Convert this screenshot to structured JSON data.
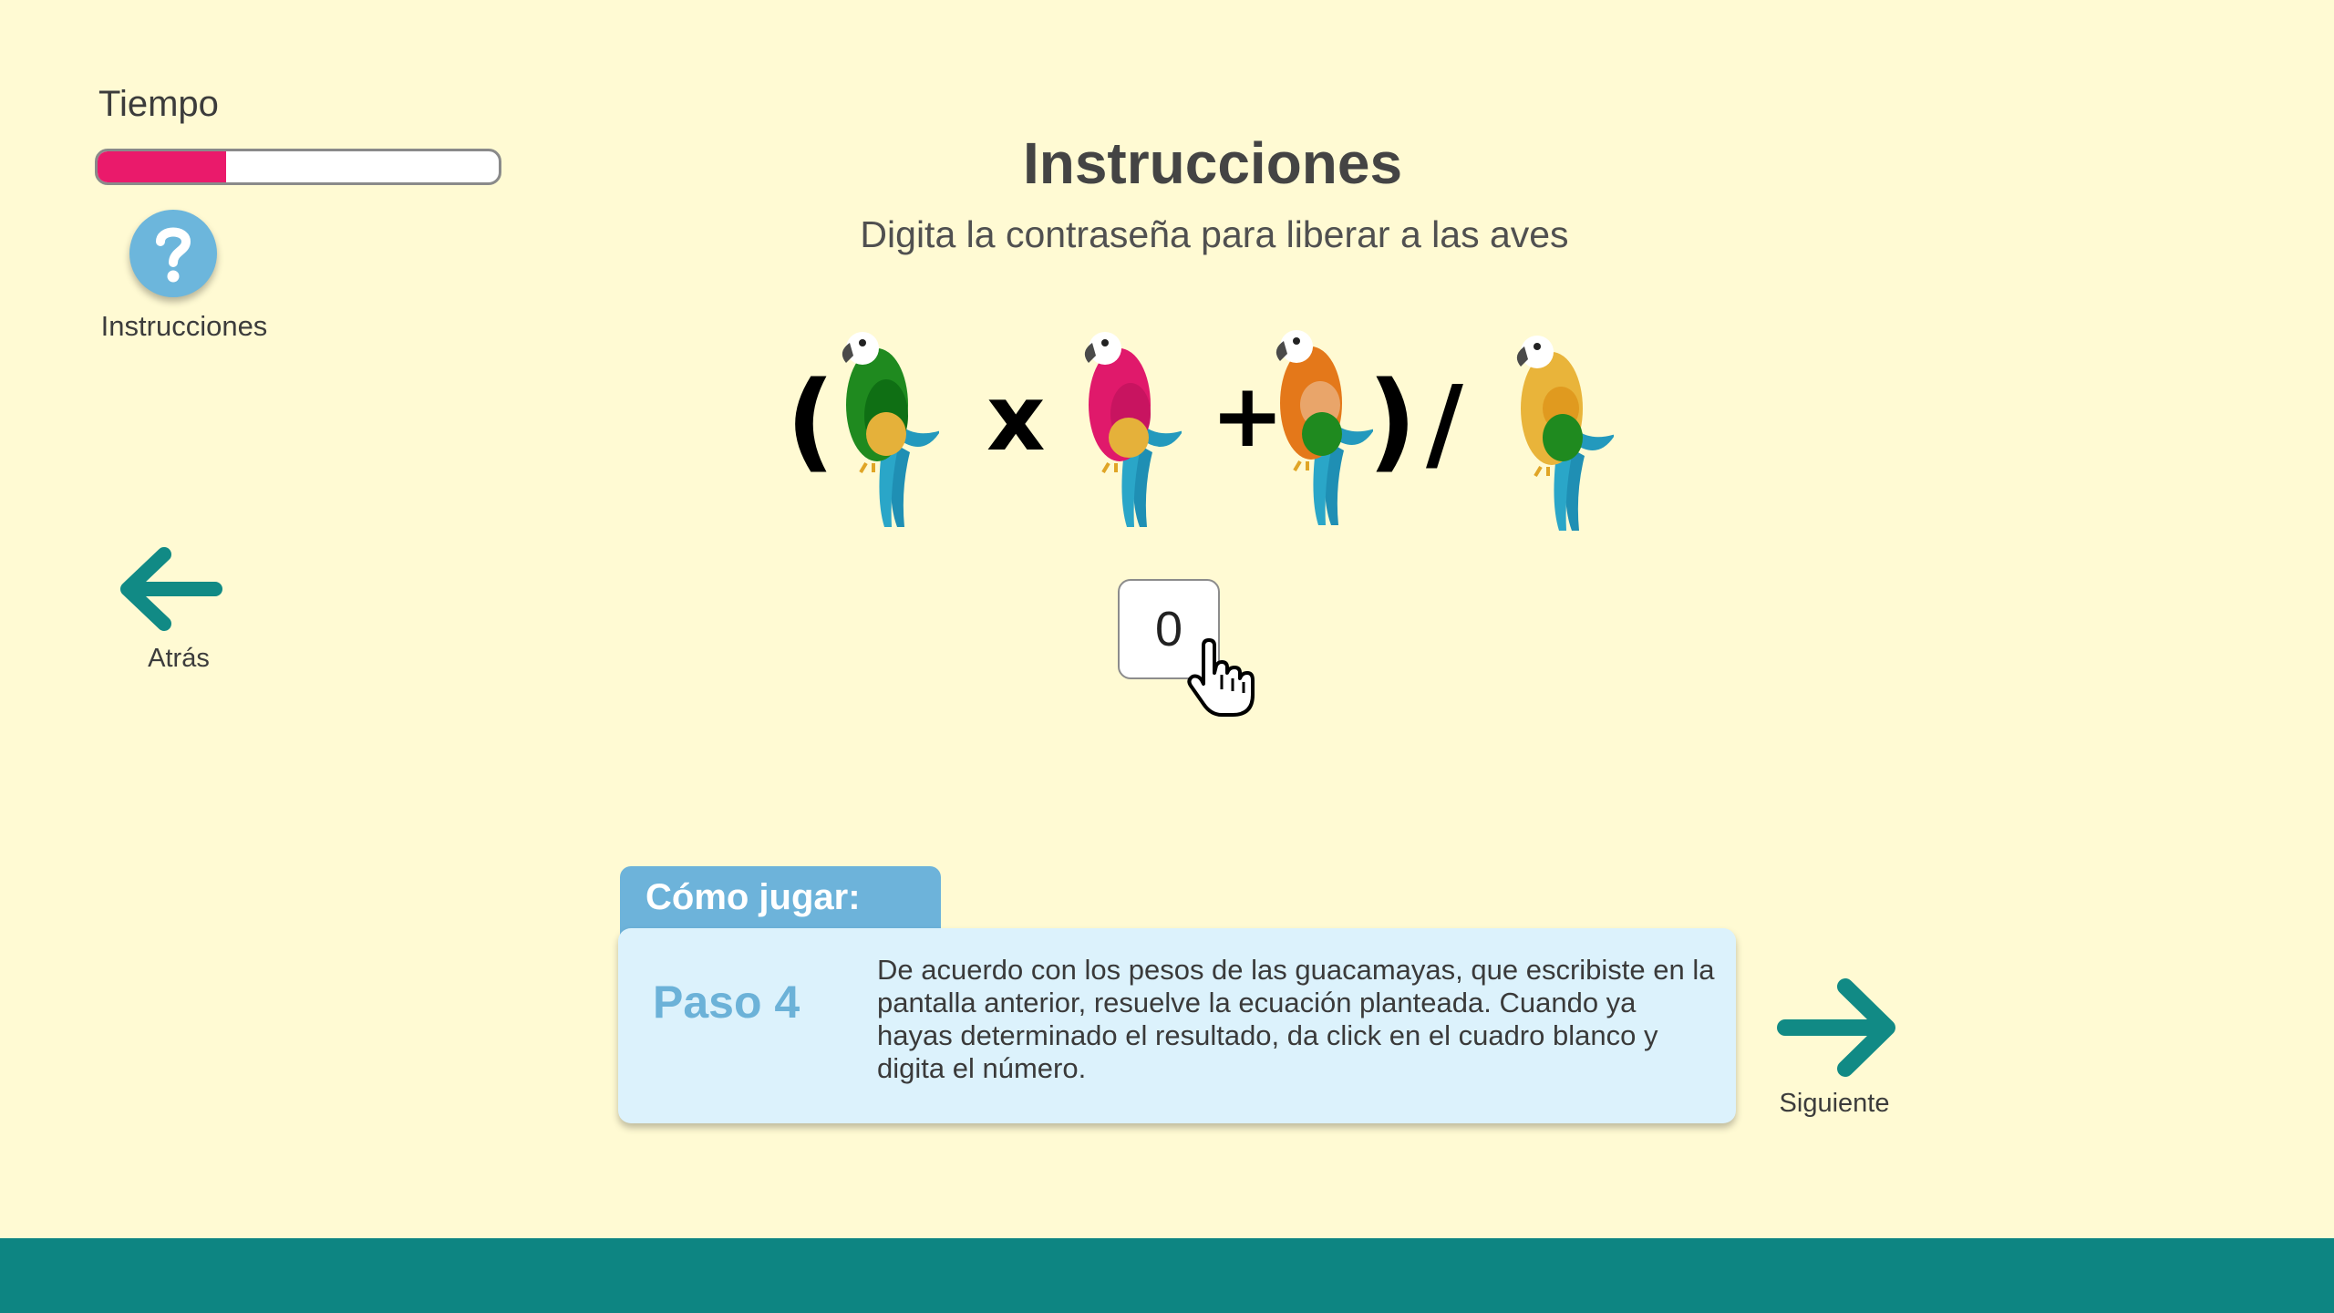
{
  "timer": {
    "label": "Tiempo",
    "progress": 0.32,
    "fill_color": "#ea1a6b"
  },
  "help": {
    "icon": "question-icon",
    "label": "Instrucciones",
    "color": "#6cb6dc"
  },
  "nav": {
    "back_label": "Atrás",
    "next_label": "Siguiente",
    "arrow_color": "#118a85"
  },
  "header": {
    "title": "Instrucciones",
    "subtitle": "Digita la contraseña para liberar a las aves"
  },
  "equation": {
    "open_paren": "(",
    "times": "x",
    "plus": "+",
    "close_paren": ")",
    "divide": "/",
    "birds": [
      "green-parrot",
      "pink-parrot",
      "orange-parrot",
      "yellow-parrot"
    ]
  },
  "answer": {
    "value": "0"
  },
  "howto": {
    "tab_label": "Cómo jugar:",
    "step_label": "Paso 4",
    "step_text": "De acuerdo con los pesos de las guacamayas, que escribiste en la pantalla anterior, resuelve la ecuación planteada. Cuando ya hayas determinado el resultado, da click en el cuadro blanco y digita el número."
  },
  "colors": {
    "background": "#fffad3",
    "footer": "#0d8582",
    "panel": "#dcf2fc",
    "tab": "#6db3da"
  }
}
